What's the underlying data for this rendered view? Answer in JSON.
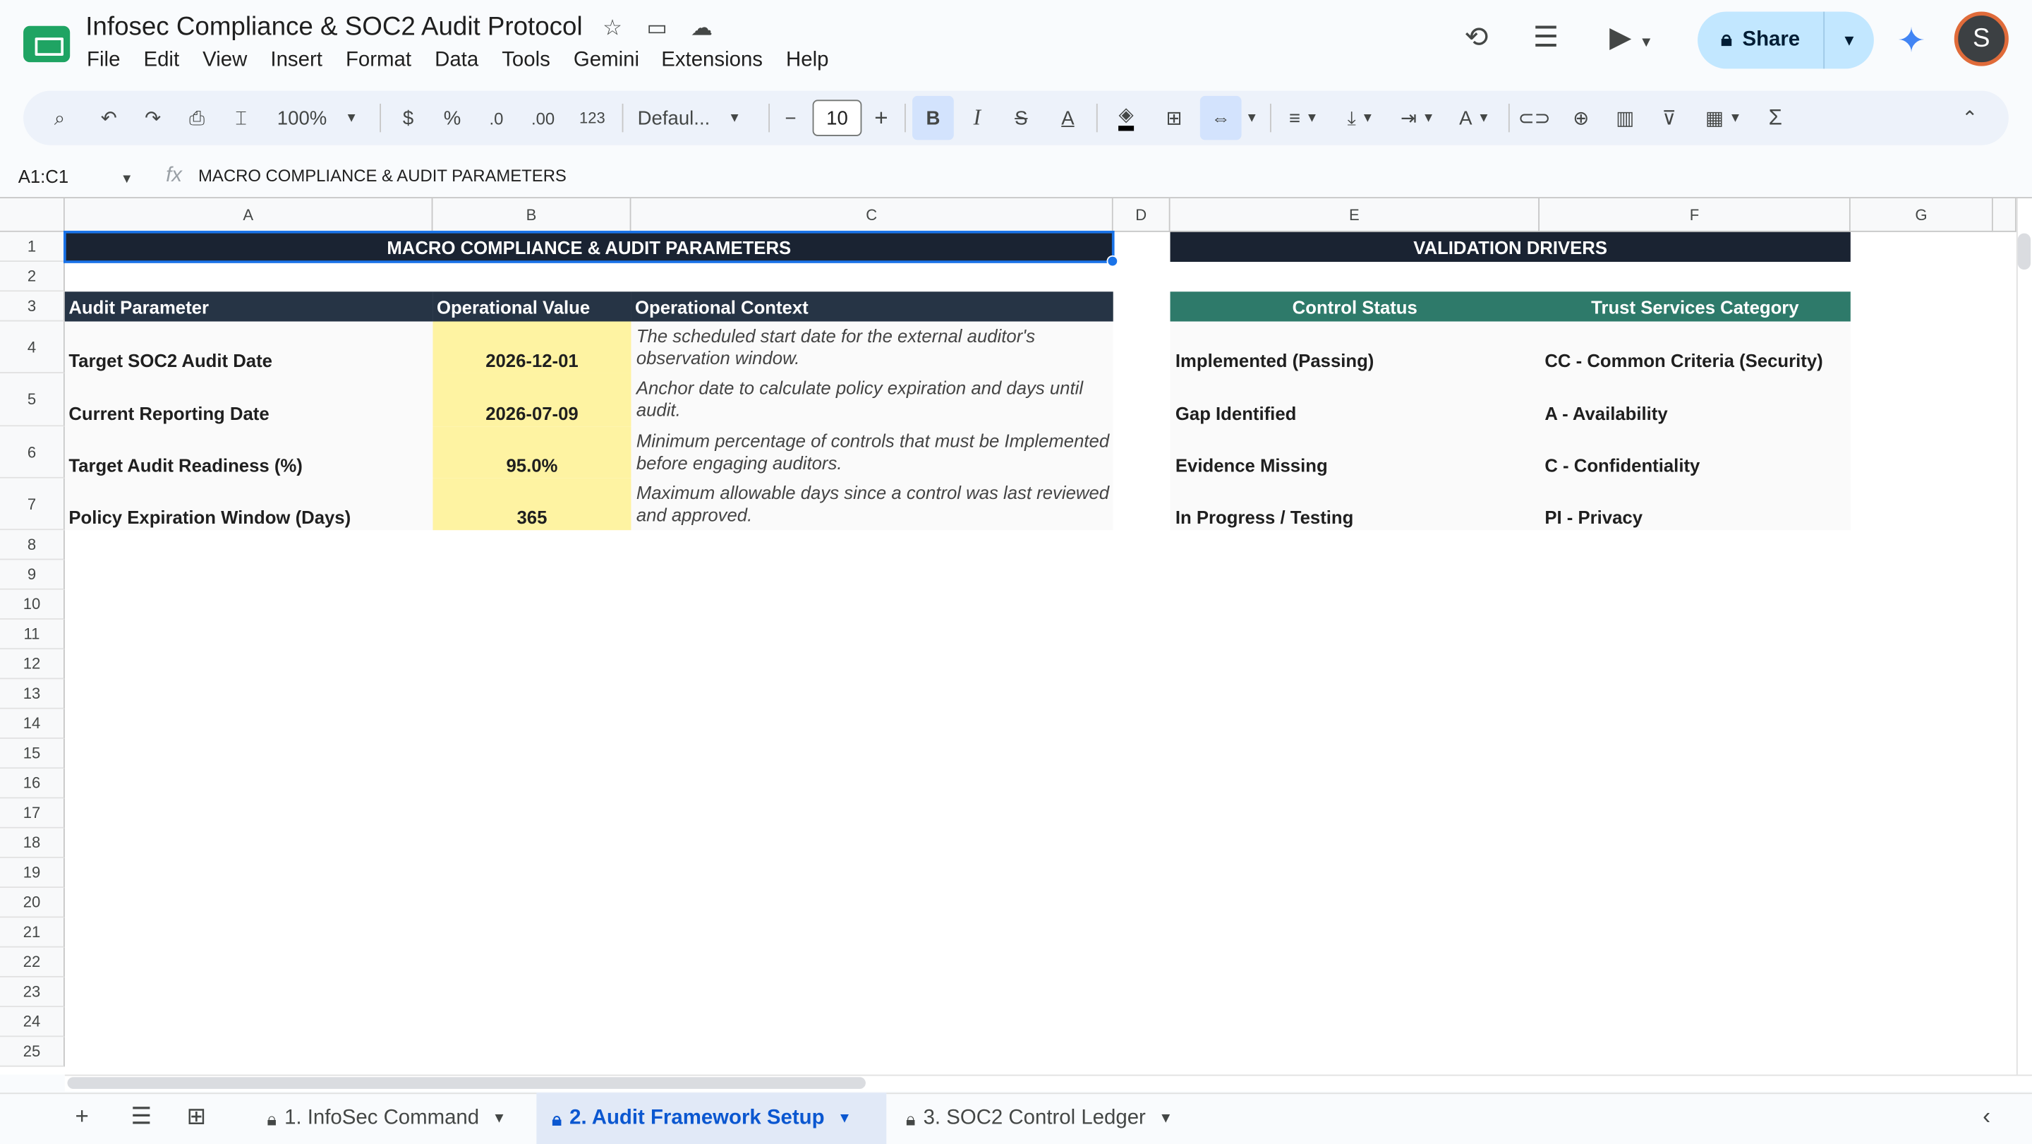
{
  "app": {
    "title": "Infosec Compliance & SOC2 Audit Protocol",
    "menu": [
      "File",
      "Edit",
      "View",
      "Insert",
      "Format",
      "Data",
      "Tools",
      "Gemini",
      "Extensions",
      "Help"
    ],
    "share_label": "Share",
    "avatar_initial": "S"
  },
  "toolbar": {
    "zoom": "100%",
    "currency": "$",
    "percent": "%",
    "dec_decrease": ".0",
    "dec_increase": ".00",
    "number_format": "123",
    "font": "Defaul...",
    "font_size": "10",
    "bold": "B",
    "italic": "I",
    "text_color": "A"
  },
  "formula_bar": {
    "name_box": "A1:C1",
    "fx": "fx",
    "value": "MACRO COMPLIANCE & AUDIT PARAMETERS"
  },
  "grid": {
    "columns": [
      "A",
      "B",
      "C",
      "D",
      "E",
      "F",
      "G"
    ],
    "rows": [
      "1",
      "2",
      "3",
      "4",
      "5",
      "6",
      "7",
      "8",
      "9",
      "10",
      "11",
      "12",
      "13",
      "14",
      "15",
      "16",
      "17",
      "18",
      "19",
      "20",
      "21",
      "22",
      "23",
      "24",
      "25"
    ]
  },
  "sheet": {
    "banner_left": "MACRO COMPLIANCE & AUDIT PARAMETERS",
    "banner_right": "VALIDATION DRIVERS",
    "headers": [
      "Audit Parameter",
      "Operational Value",
      "Operational Context"
    ],
    "driver_headers": [
      "Control Status",
      "Trust Services Category"
    ],
    "params": [
      {
        "label": "Target SOC2 Audit Date",
        "value": "2026-12-01",
        "context": "The scheduled start date for the external auditor's observation window."
      },
      {
        "label": "Current Reporting Date",
        "value": "2026-07-09",
        "context": "Anchor date to calculate policy expiration and days until audit."
      },
      {
        "label": "Target Audit Readiness (%)",
        "value": "95.0%",
        "context": "Minimum percentage of controls that must be Implemented before engaging auditors."
      },
      {
        "label": "Policy Expiration Window (Days)",
        "value": "365",
        "context": "Maximum allowable days since a control was last reviewed and approved."
      }
    ],
    "control_status": [
      "Implemented (Passing)",
      "Gap Identified",
      "Evidence Missing",
      "In Progress / Testing"
    ],
    "trust_categories": [
      "CC - Common Criteria (Security)",
      "A - Availability",
      "C - Confidentiality",
      "PI - Privacy"
    ]
  },
  "tabs": [
    {
      "label": "1. InfoSec Command"
    },
    {
      "label": "2. Audit Framework Setup"
    },
    {
      "label": "3. SOC2 Control Ledger"
    }
  ],
  "colors": {
    "banner": "#1a2332",
    "header_dark": "#263445",
    "header_green": "#2e7a6a",
    "value_fill": "#fef3a2",
    "accent": "#0b57d0"
  }
}
